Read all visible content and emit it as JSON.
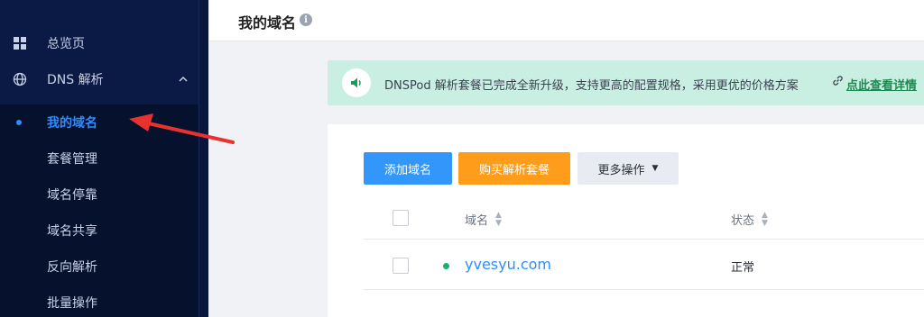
{
  "sidebar": {
    "items": [
      {
        "label": "总览页",
        "icon": "grid-icon"
      },
      {
        "label": "DNS 解析",
        "icon": "globe-icon",
        "expanded": true
      }
    ],
    "sub_items": [
      {
        "label": "我的域名",
        "active": true
      },
      {
        "label": "套餐管理"
      },
      {
        "label": "域名停靠"
      },
      {
        "label": "域名共享"
      },
      {
        "label": "反向解析"
      },
      {
        "label": "批量操作"
      }
    ]
  },
  "header": {
    "title": "我的域名",
    "info_icon": "info-icon",
    "info_glyph": "i"
  },
  "notice": {
    "icon": "speaker-icon",
    "text": "DNSPod 解析套餐已完成全新升级，支持更高的配置规格，采用更优的价格方案",
    "link_icon": "link-icon",
    "link_text": "点此查看详情"
  },
  "toolbar": {
    "add_label": "添加域名",
    "buy_label": "购买解析套餐",
    "more_label": "更多操作"
  },
  "table": {
    "columns": [
      "域名",
      "状态"
    ],
    "rows": [
      {
        "domain": "yvesyu.com",
        "status": "正常"
      }
    ]
  },
  "colors": {
    "sidebar_bg": "#0b1a44",
    "accent": "#2e8cff",
    "primary_button": "#3296fa",
    "orange_button": "#ff9c19",
    "notice_bg": "#c9efe3",
    "status_ok": "#17b26a",
    "annotation_arrow": "#e8322f"
  }
}
